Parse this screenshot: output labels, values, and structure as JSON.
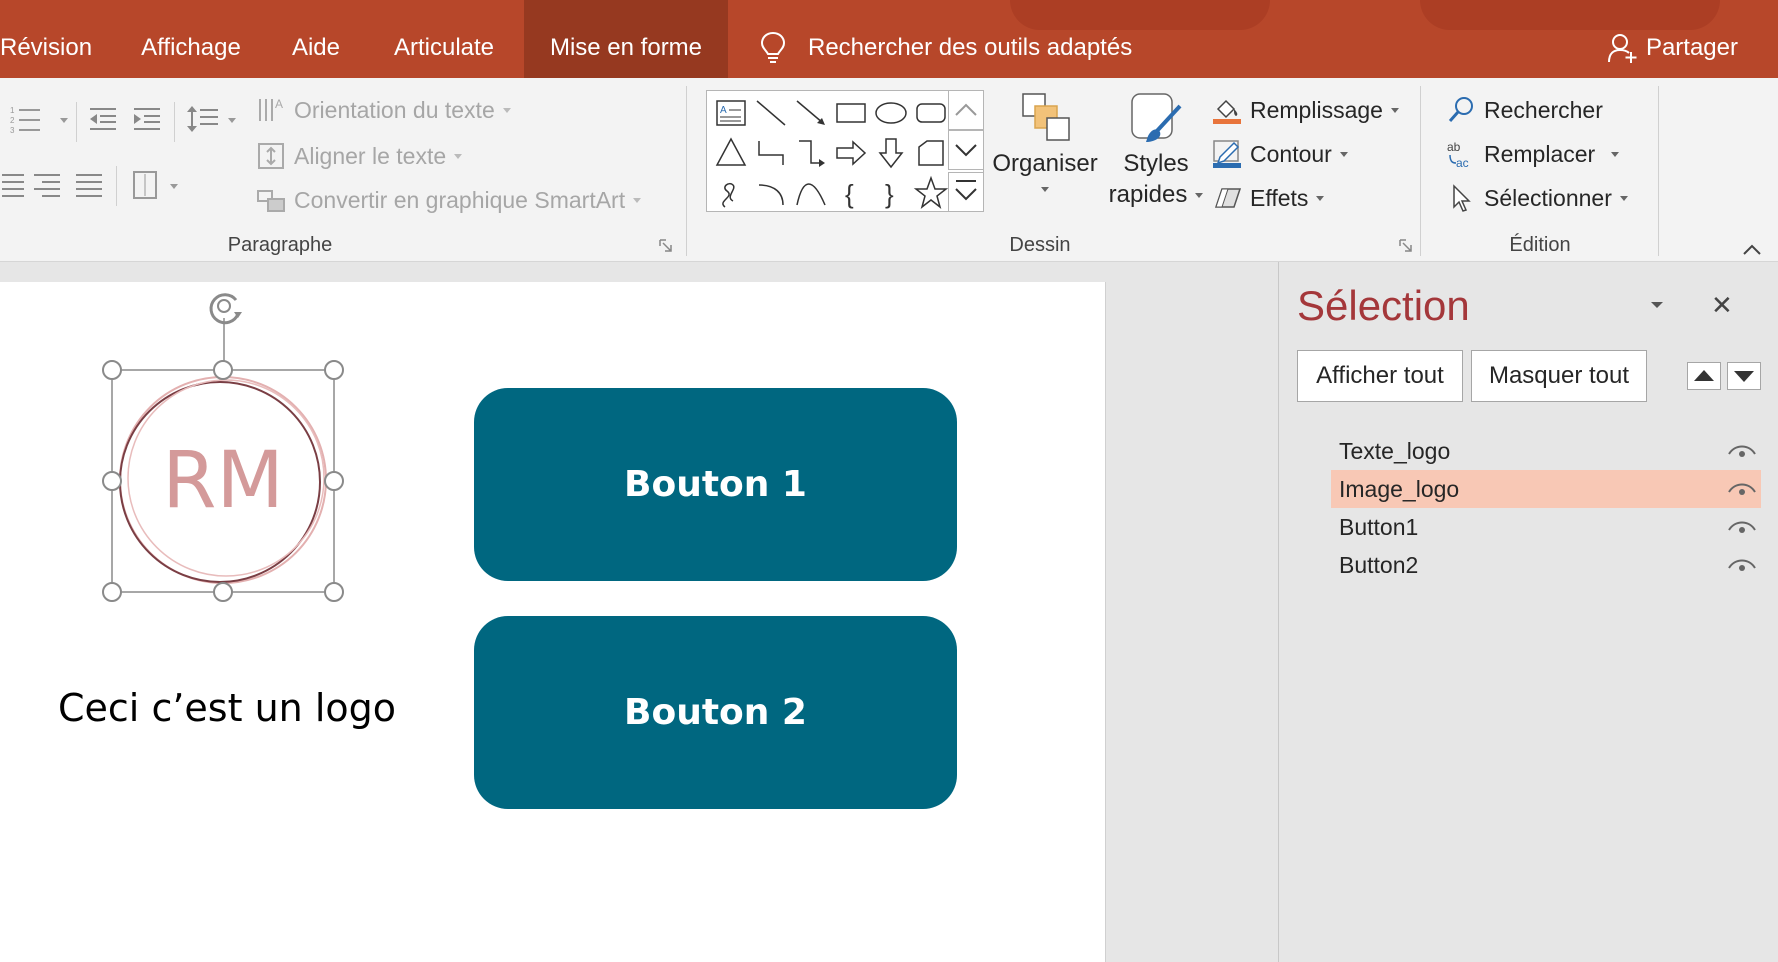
{
  "tabs": [
    {
      "label": "Révision",
      "active": false
    },
    {
      "label": "Affichage",
      "active": false
    },
    {
      "label": "Aide",
      "active": false
    },
    {
      "label": "Articulate",
      "active": false
    },
    {
      "label": "Mise en forme",
      "active": true
    }
  ],
  "tell_me": "Rechercher des outils adaptés",
  "share": "Partager",
  "ribbon": {
    "paragraph": {
      "label": "Paragraphe",
      "text_direction": "Orientation du texte",
      "align_text": "Aligner le texte",
      "smartart": "Convertir en graphique SmartArt"
    },
    "drawing": {
      "label": "Dessin",
      "arrange": [
        "Organiser"
      ],
      "quick_styles": [
        "Styles",
        "rapides"
      ],
      "fill": "Remplissage",
      "outline": "Contour",
      "effects": "Effets"
    },
    "editing": {
      "label": "Édition",
      "find": "Rechercher",
      "replace": "Remplacer",
      "select": "Sélectionner"
    }
  },
  "slide": {
    "logo_initials": "RM",
    "logo_caption": "Ceci c’est un logo",
    "button1": "Bouton 1",
    "button2": "Bouton 2"
  },
  "selection_pane": {
    "title": "Sélection",
    "show_all": "Afficher tout",
    "hide_all": "Masquer tout",
    "layers": [
      {
        "name": "Texte_logo",
        "selected": false,
        "visible": true
      },
      {
        "name": "Image_logo",
        "selected": true,
        "visible": true
      },
      {
        "name": "Button1",
        "selected": false,
        "visible": true
      },
      {
        "name": "Button2",
        "selected": false,
        "visible": true
      }
    ]
  },
  "colors": {
    "ribbon_tab_bar": "#b7472a",
    "active_tab": "#963920",
    "button_fill": "#006780",
    "pane_title": "#a4373a",
    "selected_layer": "#f8c8b5",
    "logo_pink": "#d49a9a"
  }
}
